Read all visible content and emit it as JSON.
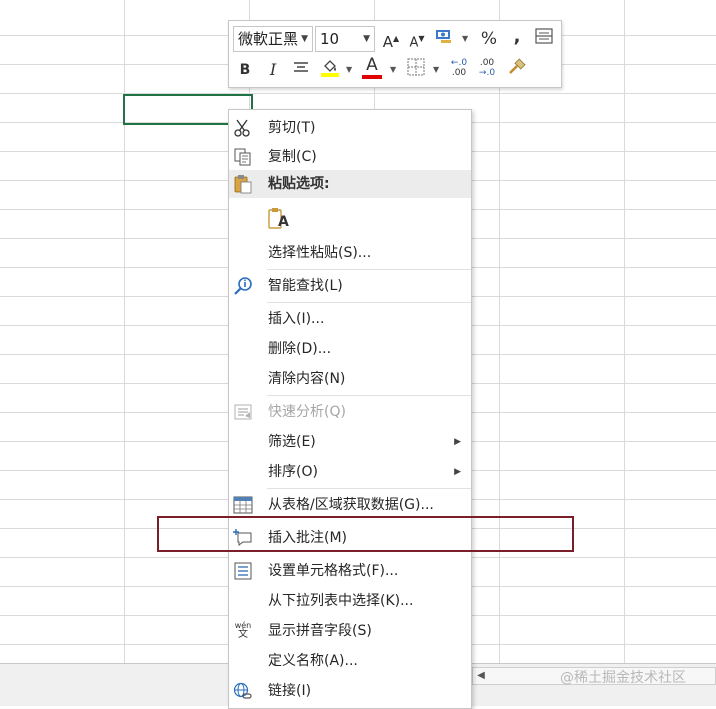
{
  "mini_toolbar": {
    "font_name": "微軟正黑",
    "font_size": "10",
    "increase_font": "A",
    "decrease_font": "A",
    "percent": "%",
    "comma": ",",
    "bold": "B",
    "italic": "I",
    "font_color_glyph": "A",
    "inc_decimal_top": "←.0",
    "inc_decimal_bottom": ".00",
    "dec_decimal_top": ".00",
    "dec_decimal_bottom": "→.0"
  },
  "context_menu": {
    "cut": "剪切(T)",
    "copy": "复制(C)",
    "paste_options": "粘贴选项:",
    "paste_glyph": "A",
    "paste_special": "选择性粘贴(S)...",
    "smart_lookup": "智能查找(L)",
    "insert": "插入(I)...",
    "delete": "删除(D)...",
    "clear_contents": "清除内容(N)",
    "quick_analysis": "快速分析(Q)",
    "filter": "筛选(E)",
    "sort": "排序(O)",
    "get_data": "从表格/区域获取数据(G)...",
    "insert_comment": "插入批注(M)",
    "format_cells": "设置单元格格式(F)...",
    "pick_from_list": "从下拉列表中选择(K)...",
    "phonetic": "显示拼音字段(S)",
    "define_name": "定义名称(A)...",
    "link": "链接(I)",
    "phonetic_icon_top": "wén",
    "phonetic_icon_bottom": "文"
  },
  "watermark": "@稀土掘金技术社区",
  "colors": {
    "selection_border": "#217346",
    "highlight_border": "#7a1f2a",
    "font_color_bar": "#e00000",
    "fill_color_bar": "#ffff00"
  }
}
